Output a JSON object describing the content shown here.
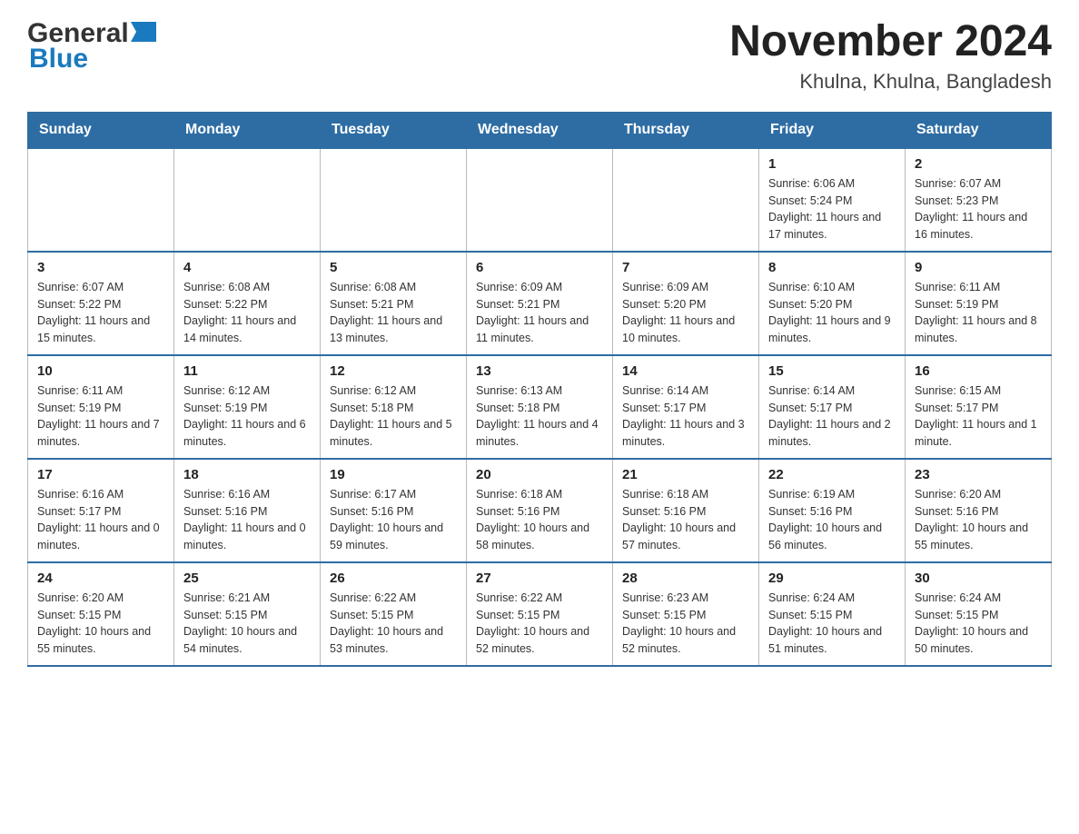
{
  "header": {
    "logo": {
      "general": "General",
      "blue": "Blue",
      "arrow": "▶"
    },
    "title": "November 2024",
    "location": "Khulna, Khulna, Bangladesh"
  },
  "calendar": {
    "days_of_week": [
      "Sunday",
      "Monday",
      "Tuesday",
      "Wednesday",
      "Thursday",
      "Friday",
      "Saturday"
    ],
    "weeks": [
      [
        {
          "day": "",
          "info": ""
        },
        {
          "day": "",
          "info": ""
        },
        {
          "day": "",
          "info": ""
        },
        {
          "day": "",
          "info": ""
        },
        {
          "day": "",
          "info": ""
        },
        {
          "day": "1",
          "info": "Sunrise: 6:06 AM\nSunset: 5:24 PM\nDaylight: 11 hours and 17 minutes."
        },
        {
          "day": "2",
          "info": "Sunrise: 6:07 AM\nSunset: 5:23 PM\nDaylight: 11 hours and 16 minutes."
        }
      ],
      [
        {
          "day": "3",
          "info": "Sunrise: 6:07 AM\nSunset: 5:22 PM\nDaylight: 11 hours and 15 minutes."
        },
        {
          "day": "4",
          "info": "Sunrise: 6:08 AM\nSunset: 5:22 PM\nDaylight: 11 hours and 14 minutes."
        },
        {
          "day": "5",
          "info": "Sunrise: 6:08 AM\nSunset: 5:21 PM\nDaylight: 11 hours and 13 minutes."
        },
        {
          "day": "6",
          "info": "Sunrise: 6:09 AM\nSunset: 5:21 PM\nDaylight: 11 hours and 11 minutes."
        },
        {
          "day": "7",
          "info": "Sunrise: 6:09 AM\nSunset: 5:20 PM\nDaylight: 11 hours and 10 minutes."
        },
        {
          "day": "8",
          "info": "Sunrise: 6:10 AM\nSunset: 5:20 PM\nDaylight: 11 hours and 9 minutes."
        },
        {
          "day": "9",
          "info": "Sunrise: 6:11 AM\nSunset: 5:19 PM\nDaylight: 11 hours and 8 minutes."
        }
      ],
      [
        {
          "day": "10",
          "info": "Sunrise: 6:11 AM\nSunset: 5:19 PM\nDaylight: 11 hours and 7 minutes."
        },
        {
          "day": "11",
          "info": "Sunrise: 6:12 AM\nSunset: 5:19 PM\nDaylight: 11 hours and 6 minutes."
        },
        {
          "day": "12",
          "info": "Sunrise: 6:12 AM\nSunset: 5:18 PM\nDaylight: 11 hours and 5 minutes."
        },
        {
          "day": "13",
          "info": "Sunrise: 6:13 AM\nSunset: 5:18 PM\nDaylight: 11 hours and 4 minutes."
        },
        {
          "day": "14",
          "info": "Sunrise: 6:14 AM\nSunset: 5:17 PM\nDaylight: 11 hours and 3 minutes."
        },
        {
          "day": "15",
          "info": "Sunrise: 6:14 AM\nSunset: 5:17 PM\nDaylight: 11 hours and 2 minutes."
        },
        {
          "day": "16",
          "info": "Sunrise: 6:15 AM\nSunset: 5:17 PM\nDaylight: 11 hours and 1 minute."
        }
      ],
      [
        {
          "day": "17",
          "info": "Sunrise: 6:16 AM\nSunset: 5:17 PM\nDaylight: 11 hours and 0 minutes."
        },
        {
          "day": "18",
          "info": "Sunrise: 6:16 AM\nSunset: 5:16 PM\nDaylight: 11 hours and 0 minutes."
        },
        {
          "day": "19",
          "info": "Sunrise: 6:17 AM\nSunset: 5:16 PM\nDaylight: 10 hours and 59 minutes."
        },
        {
          "day": "20",
          "info": "Sunrise: 6:18 AM\nSunset: 5:16 PM\nDaylight: 10 hours and 58 minutes."
        },
        {
          "day": "21",
          "info": "Sunrise: 6:18 AM\nSunset: 5:16 PM\nDaylight: 10 hours and 57 minutes."
        },
        {
          "day": "22",
          "info": "Sunrise: 6:19 AM\nSunset: 5:16 PM\nDaylight: 10 hours and 56 minutes."
        },
        {
          "day": "23",
          "info": "Sunrise: 6:20 AM\nSunset: 5:16 PM\nDaylight: 10 hours and 55 minutes."
        }
      ],
      [
        {
          "day": "24",
          "info": "Sunrise: 6:20 AM\nSunset: 5:15 PM\nDaylight: 10 hours and 55 minutes."
        },
        {
          "day": "25",
          "info": "Sunrise: 6:21 AM\nSunset: 5:15 PM\nDaylight: 10 hours and 54 minutes."
        },
        {
          "day": "26",
          "info": "Sunrise: 6:22 AM\nSunset: 5:15 PM\nDaylight: 10 hours and 53 minutes."
        },
        {
          "day": "27",
          "info": "Sunrise: 6:22 AM\nSunset: 5:15 PM\nDaylight: 10 hours and 52 minutes."
        },
        {
          "day": "28",
          "info": "Sunrise: 6:23 AM\nSunset: 5:15 PM\nDaylight: 10 hours and 52 minutes."
        },
        {
          "day": "29",
          "info": "Sunrise: 6:24 AM\nSunset: 5:15 PM\nDaylight: 10 hours and 51 minutes."
        },
        {
          "day": "30",
          "info": "Sunrise: 6:24 AM\nSunset: 5:15 PM\nDaylight: 10 hours and 50 minutes."
        }
      ]
    ]
  }
}
